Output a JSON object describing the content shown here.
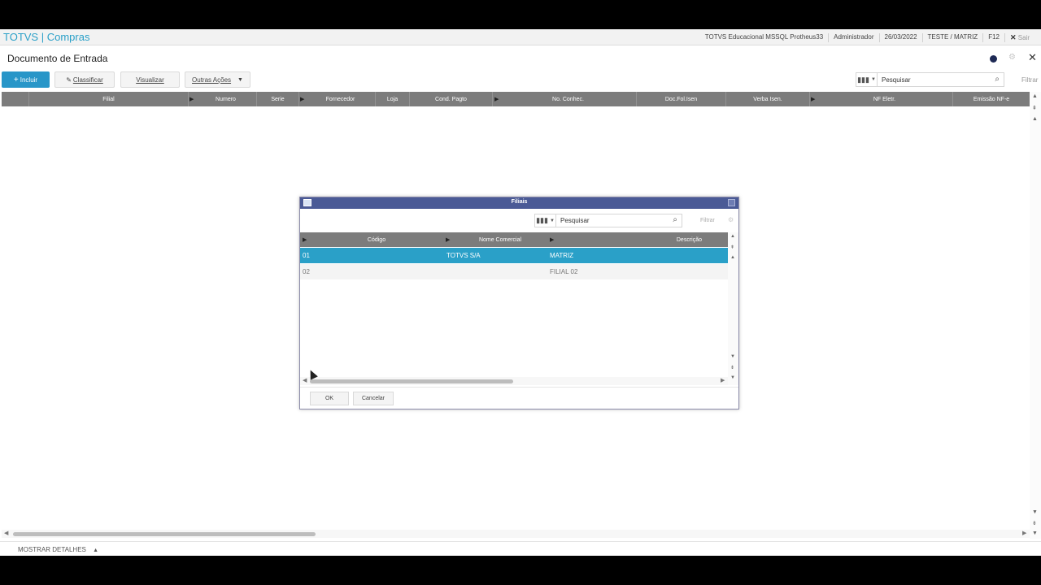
{
  "topbar": {
    "brand": "TOTVS | Compras",
    "env": "TOTVS Educacional MSSQL Protheus33",
    "user": "Administrador",
    "date": "26/03/2022",
    "company": "TESTE / MATRIZ",
    "help_key": "F12",
    "exit_label": "Sair"
  },
  "page": {
    "title": "Documento de Entrada"
  },
  "toolbar": {
    "add_label": "Incluir",
    "classify_label": "Classificar",
    "view_label": "Visualizar",
    "other_label": "Outras Ações",
    "search_placeholder": "Pesquisar",
    "filter_label": "Filtrar"
  },
  "grid": {
    "columns": [
      "Filial",
      "Numero",
      "Serie",
      "Fornecedor",
      "Loja",
      "Cond. Pagto",
      "No. Conhec.",
      "Doc.Fol.Isen",
      "Verba Isen.",
      "NF Eletr.",
      "Emissão NF-e"
    ]
  },
  "footer": {
    "details_label": "MOSTRAR DETALHES"
  },
  "dialog": {
    "title": "Filiais",
    "search_placeholder": "Pesquisar",
    "filter_label": "Filtrar",
    "columns": [
      "Código",
      "Nome Comercial",
      "Descrição"
    ],
    "rows": [
      {
        "code": "01",
        "name": "TOTVS S/A",
        "desc": "MATRIZ"
      },
      {
        "code": "02",
        "name": "",
        "desc": "FILIAL 02"
      }
    ],
    "ok_label": "OK",
    "cancel_label": "Cancelar"
  },
  "colors": {
    "brand": "#2aa0c8",
    "header": "#7c7c7c",
    "selected": "#2aa0c8",
    "dialog_title": "#4a5a96"
  }
}
